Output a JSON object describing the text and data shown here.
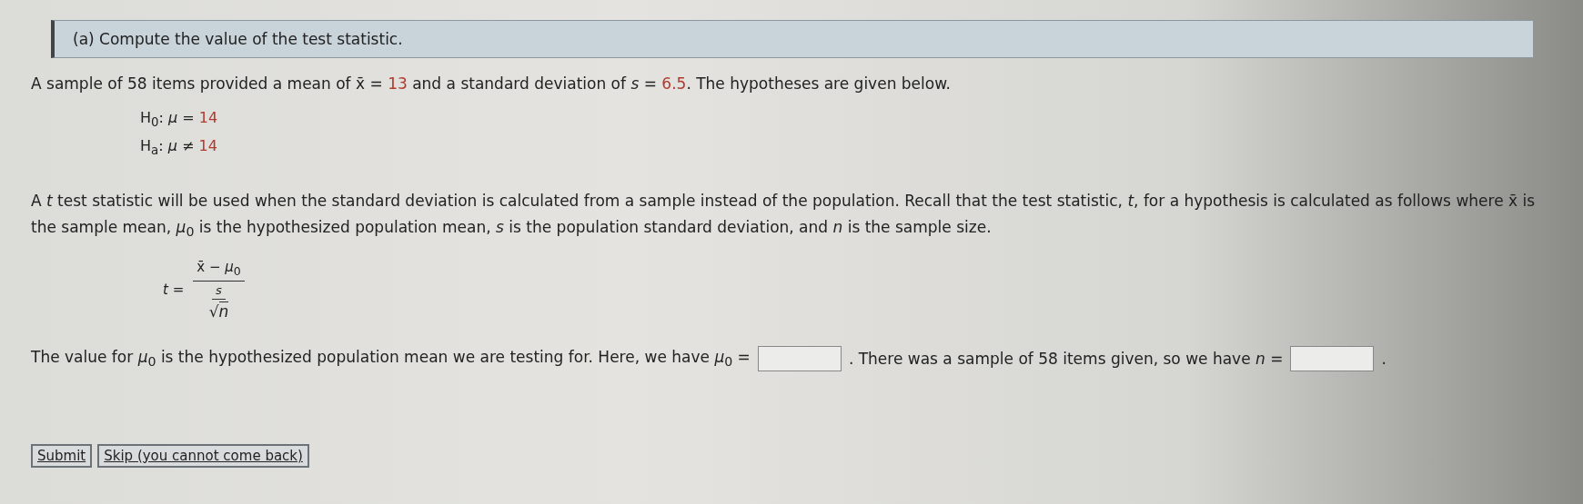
{
  "header": {
    "title": "(a) Compute the value of the test statistic."
  },
  "intro": [
    {
      "kind": "plain",
      "text": "A sample of 58 items provided a mean of x̄ = "
    },
    {
      "kind": "value",
      "text": "13"
    },
    {
      "kind": "plain",
      "text": " and a standard deviation of *s* = "
    },
    {
      "kind": "value",
      "text": "6.5"
    },
    {
      "kind": "plain",
      "text": ". The hypotheses are given below."
    }
  ],
  "hypotheses": [
    {
      "label": "H$_{0}$: *μ* = ",
      "value": "14"
    },
    {
      "label": "H$_{a}$: *μ* ≠ ",
      "value": "14"
    }
  ],
  "explanation": "A *t* test statistic will be used when the standard deviation is calculated from a sample instead of the population. Recall that the test statistic, *t*, for a hypothesis is calculated as follows where x̄ is the sample mean, *μ*$_{0}$ is the hypothesized population mean, *s* is the population standard deviation, and *n* is the sample size.",
  "formula": {
    "lhs": "*t* =",
    "numerator": "x̄ − *μ*$_{0}$",
    "denominator_top": "*s*",
    "radical": "√",
    "denominator_bottom": "*n*"
  },
  "question": [
    {
      "kind": "text",
      "text": "The value for *μ*$_{0}$ is the hypothesized population mean we are testing for. Here, we have *μ*$_{0}$ ="
    },
    {
      "kind": "input"
    },
    {
      "kind": "text",
      "text": ". There was a sample of 58 items given, so we have *n* ="
    },
    {
      "kind": "input"
    },
    {
      "kind": "text",
      "text": "."
    }
  ],
  "buttons": [
    "Submit",
    "Skip (you cannot come back)"
  ]
}
